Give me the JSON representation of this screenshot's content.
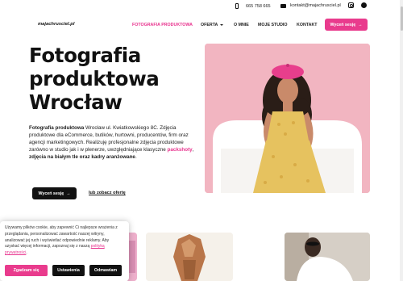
{
  "topbar": {
    "phone": "665 758 665",
    "email": "kontakt@majachrusciel.pl",
    "icons": [
      "phone-icon",
      "mail-icon",
      "instagram-icon",
      "facebook-icon"
    ]
  },
  "logo": "majachrusciel.pl",
  "nav": {
    "items": [
      {
        "label": "FOTOGRAFIA PRODUKTOWA"
      },
      {
        "label": "OFERTA"
      },
      {
        "label": "O MNIE"
      },
      {
        "label": "MOJE STUDIO"
      },
      {
        "label": "KONTAKT"
      }
    ],
    "cta": "Wyceń sesję"
  },
  "hero": {
    "title_line1": "Fotografia",
    "title_line2": "produktowa",
    "title_line3": "Wrocław",
    "desc_bold1": "Fotografia produktowa",
    "desc_part1": " Wrocław ul. Kwiatkowskiego 8C. Zdjęcia produktowe dla eCommerce, butików, hurtowni, producentów, firm oraz agencji marketingowych. Realizuję profesjonalne zdjęcia produktowe zarówno w studio jak i w plenerze, uwzględniające klasyczne ",
    "desc_pink": "packshoty",
    "desc_part2": ", ",
    "desc_bold2": "zdjęcia na białym tle oraz kadry aranżowane",
    "desc_end": ".",
    "cta": "Wyceń sesję",
    "link": "lub zobacz ofertę"
  },
  "cookie": {
    "text": "Używamy plików cookie, aby zapewnić Ci najlepsze wrażenia z przeglądania, personalizować zawartość naszej witryny, analizować jej ruch i wyświetlać odpowiednie reklamy. Aby uzyskać więcej informacji, zapoznaj się z naszą ",
    "link": "polityką prywatności",
    "link_end": ".",
    "accept": "Zgadzam się",
    "settings": "Ustawienia",
    "reject": "Odmawiam"
  },
  "colors": {
    "accent": "#e93b8d",
    "dark": "#111111"
  }
}
